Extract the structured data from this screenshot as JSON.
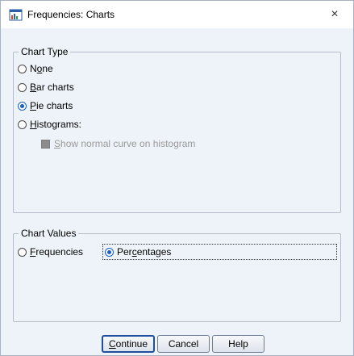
{
  "window": {
    "title": "Frequencies: Charts",
    "close_glyph": "×"
  },
  "chart_type": {
    "legend": "Chart Type",
    "options": [
      {
        "pre": "N",
        "key": "o",
        "post": "ne",
        "checked": false
      },
      {
        "pre": "",
        "key": "B",
        "post": "ar charts",
        "checked": false
      },
      {
        "pre": "",
        "key": "P",
        "post": "ie charts",
        "checked": true
      },
      {
        "pre": "",
        "key": "H",
        "post": "istograms:",
        "checked": false
      }
    ],
    "normal_curve": {
      "pre": "",
      "key": "S",
      "post": "how normal curve on histogram",
      "disabled": true
    }
  },
  "chart_values": {
    "legend": "Chart Values",
    "frequencies": {
      "pre": "",
      "key": "F",
      "post": "requencies",
      "checked": false
    },
    "percentages": {
      "pre": "Per",
      "key": "c",
      "post": "entages",
      "checked": true
    }
  },
  "buttons": {
    "continue": {
      "key": "C",
      "post": "ontinue"
    },
    "cancel": "Cancel",
    "help": "Help"
  },
  "colors": {
    "accent": "#1a5fc7",
    "dialog_bg": "#eef2f9"
  },
  "icons": {
    "app": "spss-window-icon",
    "close": "close-icon"
  }
}
